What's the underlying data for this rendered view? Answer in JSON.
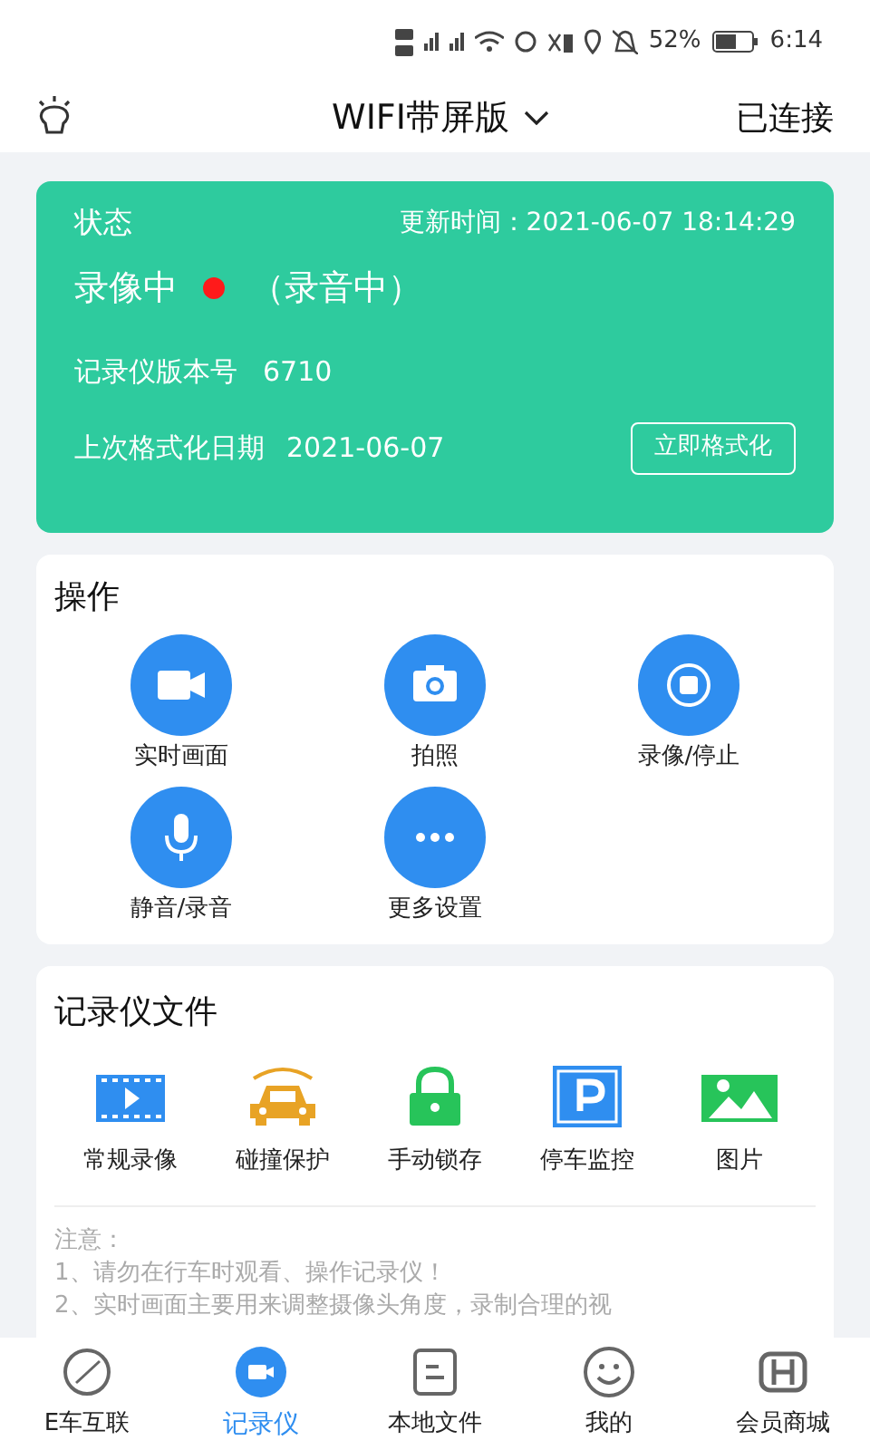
{
  "status_bar": {
    "battery": "52%",
    "time": "6:14"
  },
  "header": {
    "title": "WIFI带屏版",
    "connection": "已连接"
  },
  "status_card": {
    "label": "状态",
    "updated": "更新时间：2021-06-07 18:14:29",
    "recording": "录像中",
    "audio": "（录音中）",
    "version_label": "记录仪版本号",
    "version": "6710",
    "format_label": "上次格式化日期",
    "format_date": "2021-06-07",
    "format_button": "立即格式化"
  },
  "operations": {
    "title": "操作",
    "items": [
      {
        "kind": "camera",
        "label": "实时画面"
      },
      {
        "kind": "photo",
        "label": "拍照"
      },
      {
        "kind": "stop",
        "label": "录像/停止"
      },
      {
        "kind": "mic",
        "label": "静音/录音"
      },
      {
        "kind": "more",
        "label": "更多设置"
      }
    ]
  },
  "files": {
    "title": "记录仪文件",
    "items": [
      {
        "kind": "video",
        "label": "常规录像"
      },
      {
        "kind": "crash",
        "label": "碰撞保护"
      },
      {
        "kind": "lock",
        "label": "手动锁存"
      },
      {
        "kind": "parking",
        "label": "停车监控"
      },
      {
        "kind": "image",
        "label": "图片"
      }
    ],
    "notes": [
      "注意：",
      "1、请勿在行车时观看、操作记录仪！",
      "2、实时画面主要用来调整摄像头角度，录制合理的视"
    ]
  },
  "tab_bar": [
    {
      "kind": "link",
      "label": "E车互联",
      "selected": false
    },
    {
      "kind": "recorder",
      "label": "记录仪",
      "selected": true
    },
    {
      "kind": "files",
      "label": "本地文件",
      "selected": false
    },
    {
      "kind": "me",
      "label": "我的",
      "selected": false
    },
    {
      "kind": "shop",
      "label": "会员商城",
      "selected": false
    }
  ]
}
